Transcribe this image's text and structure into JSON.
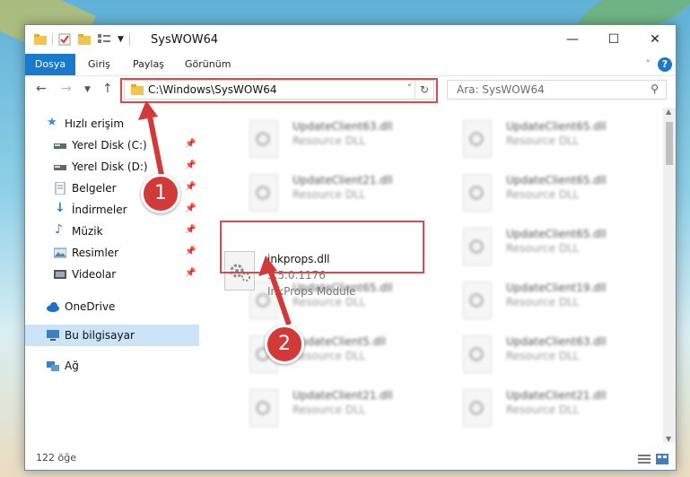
{
  "window": {
    "title": "SysWOW64",
    "controls": {
      "minimize": "—",
      "maximize": "☐",
      "close": "✕"
    }
  },
  "ribbon": {
    "tabs": [
      {
        "label": "Dosya"
      },
      {
        "label": "Giriş"
      },
      {
        "label": "Paylaş"
      },
      {
        "label": "Görünüm"
      }
    ],
    "help_icon": "?",
    "expand_icon": "˅"
  },
  "navigation": {
    "address_path": "C:\\Windows\\SysWOW64",
    "search_placeholder": "Ara: SysWOW64"
  },
  "sidebar": {
    "items": [
      {
        "label": "Hızlı erişim",
        "icon": "star-icon"
      },
      {
        "label": "Yerel Disk (C:)",
        "icon": "drive-icon",
        "pinned": true
      },
      {
        "label": "Yerel Disk (D:)",
        "icon": "drive-icon",
        "pinned": true
      },
      {
        "label": "Belgeler",
        "icon": "document-icon",
        "pinned": true
      },
      {
        "label": "İndirmeler",
        "icon": "download-icon",
        "pinned": true
      },
      {
        "label": "Müzik",
        "icon": "music-icon",
        "pinned": true
      },
      {
        "label": "Resimler",
        "icon": "pictures-icon",
        "pinned": true
      },
      {
        "label": "Videolar",
        "icon": "video-icon",
        "pinned": true
      },
      {
        "label": "OneDrive",
        "icon": "cloud-icon"
      },
      {
        "label": "Bu bilgisayar",
        "icon": "computer-icon",
        "selected": true
      },
      {
        "label": "Ağ",
        "icon": "network-icon"
      }
    ]
  },
  "files": {
    "selected": {
      "name": "inkprops.dll",
      "version": "3.5.0.1176",
      "description": "InkProps Module"
    },
    "background_tiles": [
      {
        "name": "UpdateClient63.dll",
        "desc": "Resource DLL"
      },
      {
        "name": "UpdateClient65.dll",
        "desc": "Resource DLL"
      },
      {
        "name": "UpdateClient21.dll",
        "desc": "Resource DLL"
      },
      {
        "name": "UpdateClient65.dll",
        "desc": "Resource DLL"
      },
      {
        "name": "UpdateClient65.dll",
        "desc": "Resource DLL"
      },
      {
        "name": "UpdateClient65.dll",
        "desc": "Resource DLL"
      },
      {
        "name": "UpdateClient19.dll",
        "desc": "Resource DLL"
      },
      {
        "name": "UpdateClient5.dll",
        "desc": "Resource DLL"
      },
      {
        "name": "UpdateClient63.dll",
        "desc": "Resource DLL"
      },
      {
        "name": "UpdateClient21.dll",
        "desc": "Resource DLL"
      },
      {
        "name": "UpdateClient21.dll",
        "desc": "Resource DLL"
      }
    ]
  },
  "status": {
    "item_count": "122 öğe"
  },
  "annotations": {
    "step1": "1",
    "step2": "2"
  },
  "colors": {
    "accent": "#1979ca",
    "highlight": "#d94b4b",
    "callout": "#d23a3a"
  }
}
